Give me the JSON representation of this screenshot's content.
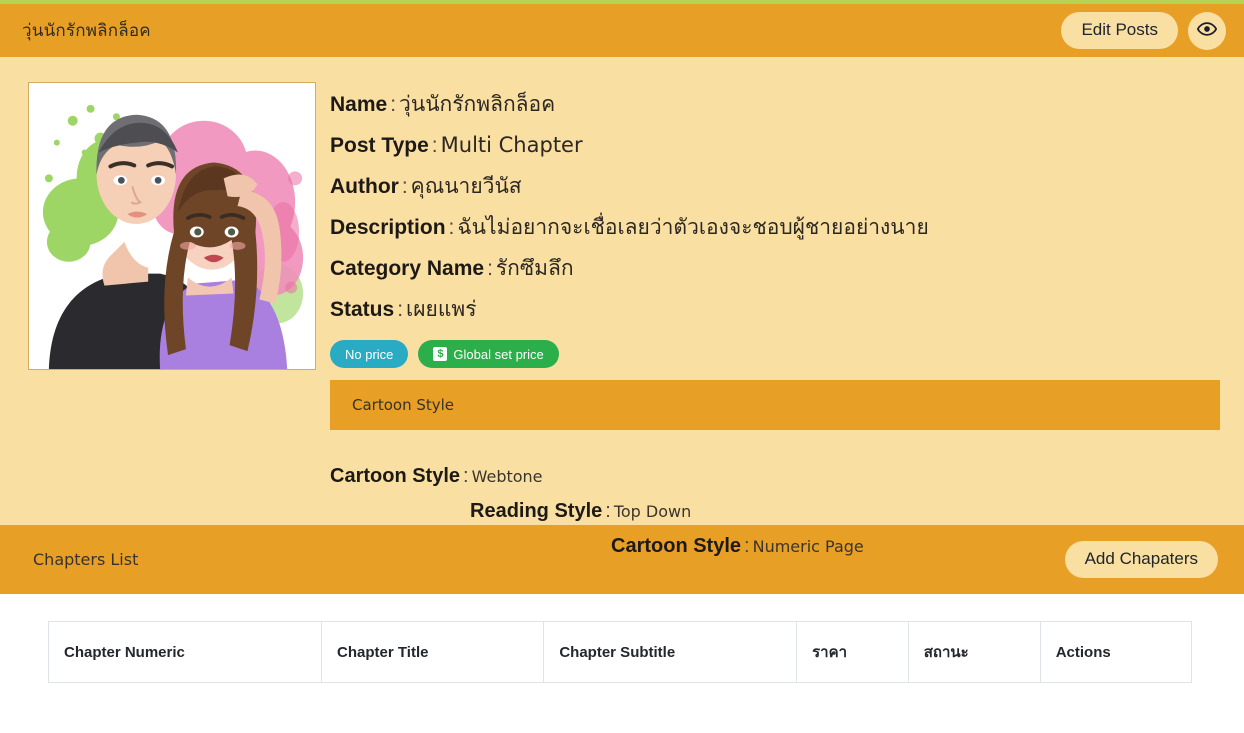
{
  "theme": {
    "accent_orange": "#e89f26",
    "cream": "#fadfa3",
    "top_strip_green": "#b6d356",
    "badge_teal": "#29abc3",
    "badge_green": "#2cae4a"
  },
  "header": {
    "title": "วุ่นนักรักพลิกล็อค",
    "edit_posts_label": "Edit Posts",
    "preview_icon": "eye-icon"
  },
  "cover": {
    "alt": "Cover illustration of a couple, man in black shirt with grey hair and woman in purple shirt with long brown hair, green and pink paint splashes"
  },
  "info": {
    "rows": [
      {
        "label": "Name",
        "sep": ":",
        "value": "วุ่นนักรักพลิกล็อค"
      },
      {
        "label": "Post Type",
        "sep": ":",
        "value": "Multi Chapter"
      },
      {
        "label": "Author",
        "sep": ":",
        "value": "คุณนายวีนัส"
      },
      {
        "label": "Description",
        "sep": ":",
        "value": "ฉันไม่อยากจะเชื่อเลยว่าตัวเองจะชอบผู้ชายอย่างนาย"
      },
      {
        "label": "Category Name",
        "sep": ":",
        "value": "รักซึมลึก"
      },
      {
        "label": "Status",
        "sep": ":",
        "value": "เผยแพร่"
      }
    ],
    "badges": [
      {
        "label": "No price",
        "color": "#29abc3",
        "icon": null
      },
      {
        "label": "Global set price",
        "color": "#2cae4a",
        "icon": "dollar-icon"
      }
    ],
    "section_banner_label": "Cartoon Style",
    "style_rows": [
      {
        "label": "Cartoon Style",
        "sep": ":",
        "value": "Webtone"
      },
      {
        "label": "Reading Style",
        "sep": ":",
        "value": "Top Down"
      },
      {
        "label": "Cartoon Style",
        "sep": ":",
        "value": "Numeric Page"
      }
    ]
  },
  "chapters": {
    "bar_title": "Chapters List",
    "add_button_label": "Add Chapaters",
    "table": {
      "headers": [
        "Chapter Numeric",
        "Chapter Title",
        "Chapter Subtitle",
        "ราคา",
        "สถานะ",
        "Actions"
      ],
      "rows": []
    }
  }
}
